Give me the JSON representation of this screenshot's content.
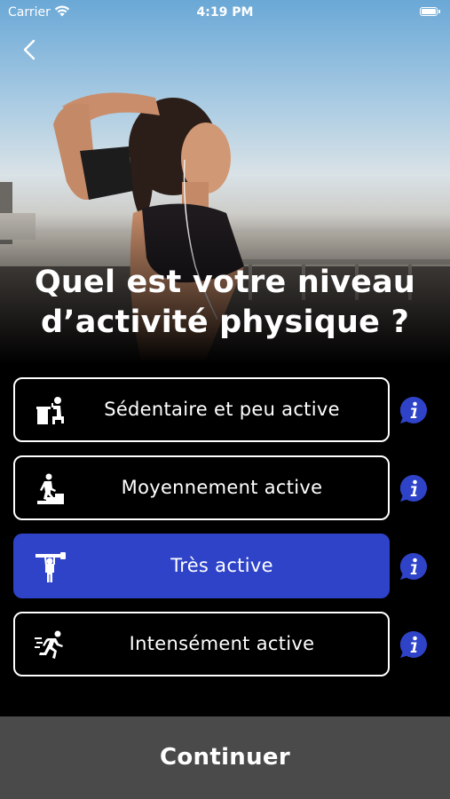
{
  "status_bar": {
    "carrier": "Carrier",
    "time": "4:19 PM"
  },
  "title": "Quel est votre niveau d’activité physique ?",
  "options": [
    {
      "label": "Sédentaire et peu active",
      "icon": "desk-person-icon",
      "selected": false
    },
    {
      "label": "Moyennement active",
      "icon": "stairs-walker-icon",
      "selected": false
    },
    {
      "label": "Très active",
      "icon": "carrying-person-icon",
      "selected": true
    },
    {
      "label": "Intensément active",
      "icon": "runner-icon",
      "selected": false
    }
  ],
  "info_icon": "info-bubble-icon",
  "continue_label": "Continuer",
  "colors": {
    "selected": "#2f43c9",
    "background": "#000000",
    "continue_bar": "#4a4a4a"
  }
}
